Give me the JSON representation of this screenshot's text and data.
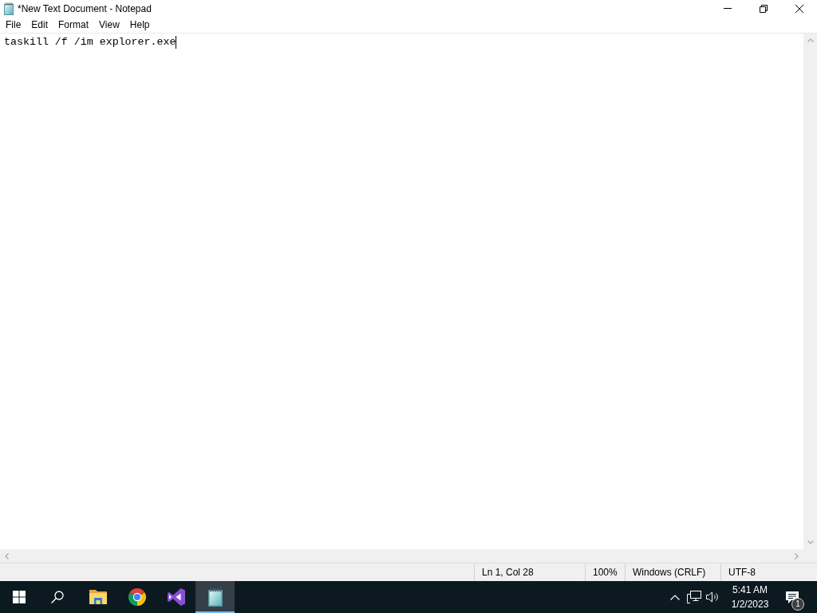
{
  "window": {
    "title": "*New Text Document - Notepad"
  },
  "menu": [
    "File",
    "Edit",
    "Format",
    "View",
    "Help"
  ],
  "editor": {
    "text": "taskill /f /im explorer.exe"
  },
  "status_bar": [
    "Ln 1, Col 28",
    "100%",
    "Windows (CRLF)",
    "UTF-8"
  ],
  "taskbar": {
    "buttons": [
      {
        "kind": "start",
        "selected": false
      },
      {
        "kind": "search",
        "selected": false
      },
      {
        "kind": "folder",
        "selected": false
      },
      {
        "kind": "browser",
        "selected": false
      },
      {
        "kind": "ide",
        "selected": false
      },
      {
        "kind": "notepad",
        "selected": true
      }
    ],
    "tray": {
      "time": "5:41 AM",
      "date": "1/2/2023",
      "notifications": "1"
    }
  }
}
